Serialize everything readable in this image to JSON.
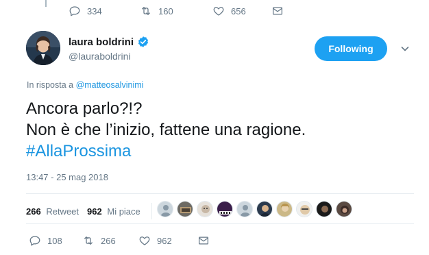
{
  "previous_tweet": {
    "actions": {
      "replies": "334",
      "retweets": "160",
      "likes": "656"
    }
  },
  "tweet": {
    "author": {
      "name": "laura boldrini",
      "handle": "@lauraboldrini",
      "verified": true
    },
    "follow_button": "Following",
    "reply_to_prefix": "In risposta a",
    "reply_to_mention": "@matteosalvinimi",
    "text_lines": [
      "Ancora parlo?!?",
      "Non è che l’inizio, fattene una ragione."
    ],
    "hashtag": "#AllaProssima",
    "timestamp": "13:47 - 25 mag 2018",
    "stats": {
      "retweets_count": "266",
      "retweets_label": "Retweet",
      "likes_count": "962",
      "likes_label": "Mi piace"
    },
    "actions": {
      "replies": "108",
      "retweets": "266",
      "likes": "962"
    }
  },
  "colors": {
    "accent": "#1da1f2",
    "link": "#1b95e0",
    "muted": "#657786",
    "text": "#14171a"
  },
  "icons": [
    "reply-icon",
    "retweet-icon",
    "like-icon",
    "dm-icon",
    "verified-badge-icon",
    "chevron-down-icon"
  ]
}
